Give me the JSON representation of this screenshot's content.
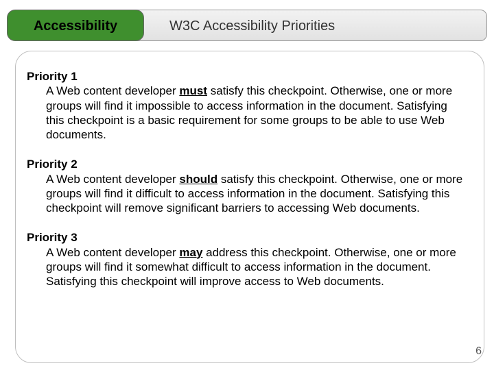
{
  "header": {
    "tab_label": "Accessibility",
    "title": "W3C Accessibility Priorities"
  },
  "priorities": [
    {
      "heading": "Priority 1",
      "prefix": "A Web content developer ",
      "keyword": "must",
      "suffix": " satisfy this checkpoint. Otherwise, one or more groups will find it impossible to access information in the document. Satisfying this checkpoint is a basic requirement for some groups to be able to use Web documents."
    },
    {
      "heading": "Priority 2",
      "prefix": "A Web content developer ",
      "keyword": "should",
      "suffix": " satisfy this checkpoint. Otherwise, one or more groups will find it difficult to access information in the document. Satisfying this checkpoint will remove significant barriers to accessing Web documents."
    },
    {
      "heading": "Priority 3",
      "prefix": "A Web content developer ",
      "keyword": "may",
      "suffix": " address this checkpoint. Otherwise, one or more groups will find it somewhat difficult to access information in the document. Satisfying this checkpoint will improve access to Web documents."
    }
  ],
  "page_number": "6"
}
